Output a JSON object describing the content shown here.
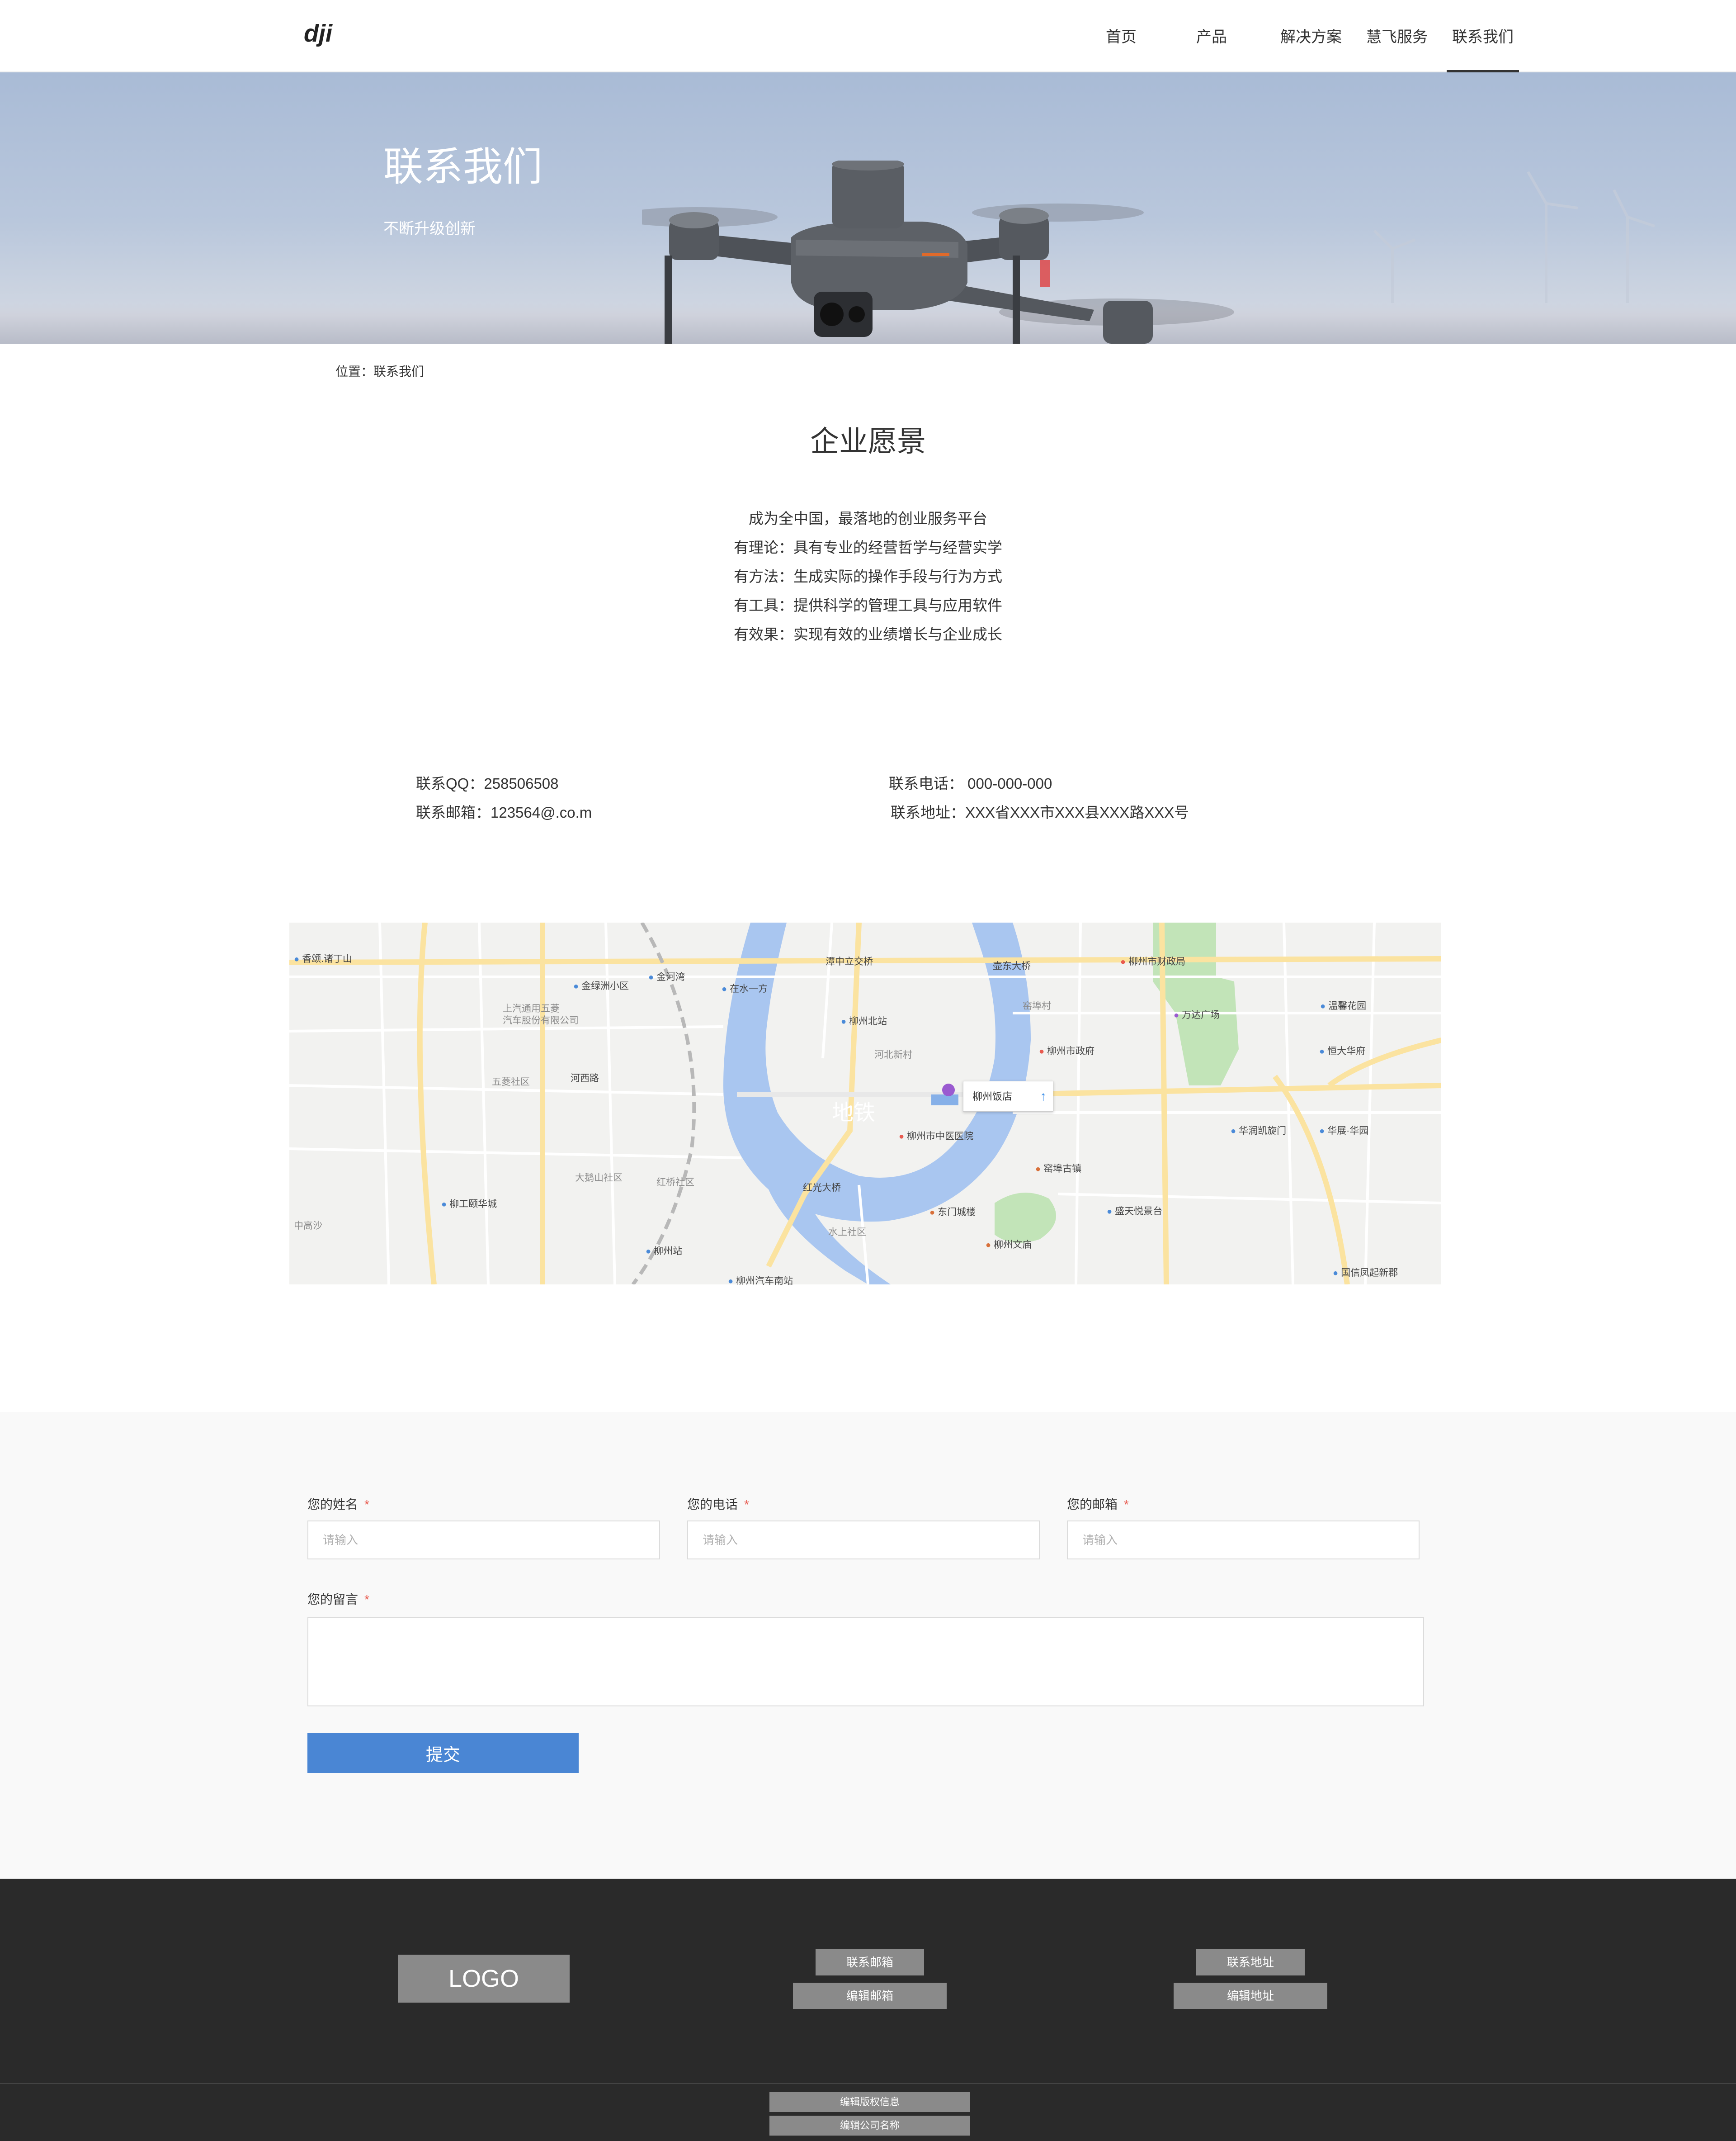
{
  "header": {
    "logo_text": "dji",
    "nav": [
      {
        "label": "首页"
      },
      {
        "label": "产品"
      },
      {
        "label": "解决方案"
      },
      {
        "label": "慧飞服务"
      },
      {
        "label": "联系我们",
        "active": true
      }
    ]
  },
  "banner": {
    "title": "联系我们",
    "subtitle": "不断升级创新"
  },
  "breadcrumb": "位置：联系我们",
  "vision": {
    "title": "企业愿景",
    "lines": [
      "成为全中国，最落地的创业服务平台",
      "有理论：具有专业的经营哲学与经营实学",
      "有方法：生成实际的操作手段与行为方式",
      "有工具：提供科学的管理工具与应用软件",
      "有效果：实现有效的业绩增长与企业成长"
    ]
  },
  "contact": {
    "qq": "联系QQ：258506508",
    "phone": "联系电话：  000-000-000",
    "email": "联系邮箱：123564@.co.m",
    "address": "联系地址：XXX省XXX市XXX县XXX路XXX号"
  },
  "map": {
    "popup": "柳州饭店",
    "labels": [
      {
        "text": "香颂.诸丁山",
        "kind": "blue"
      },
      {
        "text": "金绿洲小区",
        "kind": "blue"
      },
      {
        "text": "金河湾",
        "kind": "blue"
      },
      {
        "text": "在水一方",
        "kind": "blue"
      },
      {
        "text": "潭中立交桥",
        "kind": "plain"
      },
      {
        "text": "壶东大桥",
        "kind": "plain"
      },
      {
        "text": "柳州市财政局",
        "kind": "red"
      },
      {
        "text": "上汽通用五菱",
        "kind": "gray"
      },
      {
        "text": "汽车股份有限公司",
        "kind": "gray"
      },
      {
        "text": "柳州北站",
        "kind": "blue"
      },
      {
        "text": "窑埠村",
        "kind": "gray"
      },
      {
        "text": "万达广场",
        "kind": "purple"
      },
      {
        "text": "温馨花园",
        "kind": "blue"
      },
      {
        "text": "柳州市政府",
        "kind": "red"
      },
      {
        "text": "恒大华府",
        "kind": "blue"
      },
      {
        "text": "河北新村",
        "kind": "gray"
      },
      {
        "text": "五菱社区",
        "kind": "gray"
      },
      {
        "text": "河西路",
        "kind": "plain"
      },
      {
        "text": "地铁",
        "kind": "plain"
      },
      {
        "text": "柳州市中医医院",
        "kind": "red"
      },
      {
        "text": "华润凯旋门",
        "kind": "blue"
      },
      {
        "text": "华展·华园",
        "kind": "blue"
      },
      {
        "text": "窑埠古镇",
        "kind": "orange"
      },
      {
        "text": "大鹅山社区",
        "kind": "gray"
      },
      {
        "text": "红桥社区",
        "kind": "gray"
      },
      {
        "text": "红光大桥",
        "kind": "plain"
      },
      {
        "text": "柳工颐华城",
        "kind": "blue"
      },
      {
        "text": "东门城楼",
        "kind": "orange"
      },
      {
        "text": "盛天悦景台",
        "kind": "blue"
      },
      {
        "text": "中高沙",
        "kind": "gray"
      },
      {
        "text": "水上社区",
        "kind": "gray"
      },
      {
        "text": "柳州站",
        "kind": "blue"
      },
      {
        "text": "柳州文庙",
        "kind": "orange"
      },
      {
        "text": "柳州汽车南站",
        "kind": "blue"
      },
      {
        "text": "国信凤起新郡",
        "kind": "blue"
      }
    ]
  },
  "form": {
    "name_label": "您的姓名",
    "phone_label": "您的电话",
    "email_label": "您的邮箱",
    "message_label": "您的留言",
    "required_mark": "*",
    "placeholder": "请输入",
    "submit": "提交"
  },
  "footer": {
    "logo": "LOGO",
    "email_title": "联系邮箱",
    "email_value": "编辑邮箱",
    "address_title": "联系地址",
    "address_value": "编辑地址",
    "copyright": "编辑版权信息",
    "company": "编辑公司名称"
  },
  "colors": {
    "accent": "#4a86d4",
    "required": "#e85a4f",
    "footer_bg": "#2a2a2a",
    "river": "#a9c6f0"
  }
}
